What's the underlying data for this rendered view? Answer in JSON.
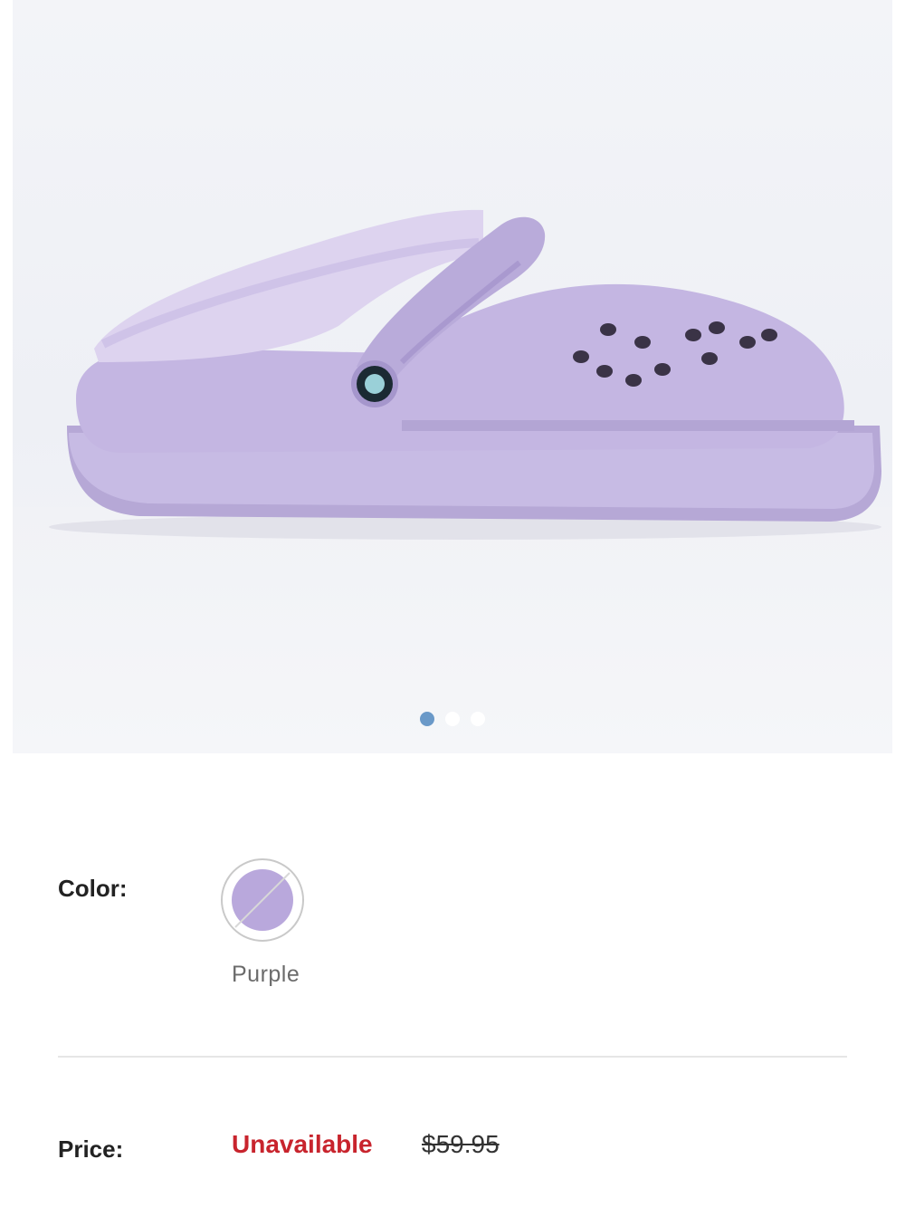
{
  "gallery": {
    "image": "purple-lined-clog-image",
    "dots": [
      {
        "active": true
      },
      {
        "active": false
      },
      {
        "active": false
      }
    ]
  },
  "color": {
    "label": "Color:",
    "selected": "Purple",
    "swatch_hex": "#b9a8dc",
    "unavailable": true
  },
  "price": {
    "label": "Price:",
    "status": "Unavailable",
    "original": "$59.95",
    "status_color": "#c8242d"
  }
}
